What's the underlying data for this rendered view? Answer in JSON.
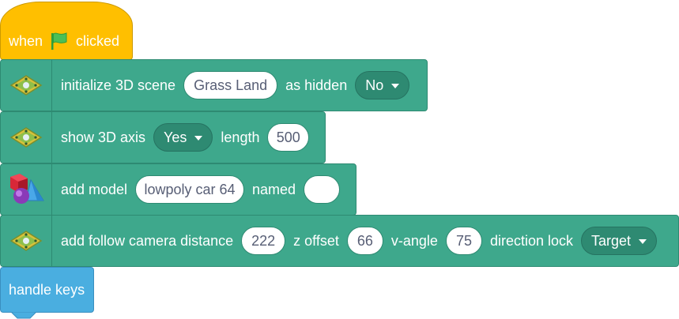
{
  "hat": {
    "when": "when",
    "clicked": "clicked",
    "icon": "green-flag-icon",
    "color": "#ffbf00"
  },
  "blocks": [
    {
      "icon": "board-icon",
      "label1": "initialize 3D scene",
      "input1": "Grass Land",
      "label2": "as hidden",
      "dropdown1": "No"
    },
    {
      "icon": "board-icon",
      "label1": "show 3D axis",
      "dropdown1": "Yes",
      "label2": "length",
      "input1": "500"
    },
    {
      "icon": "shapes-icon",
      "label1": "add model",
      "input1": "lowpoly car 64",
      "label2": "named",
      "input2": ""
    },
    {
      "icon": "board-icon",
      "label1": "add follow camera distance",
      "input1": "222",
      "label2": "z offset",
      "input2": "66",
      "label3": "v-angle",
      "input3": "75",
      "label4": "direction lock",
      "dropdown1": "Target"
    }
  ],
  "handle": {
    "label": "handle keys",
    "color": "#4aaee0"
  },
  "colors": {
    "extension": "#3ea88c",
    "input_text": "#575e75"
  }
}
